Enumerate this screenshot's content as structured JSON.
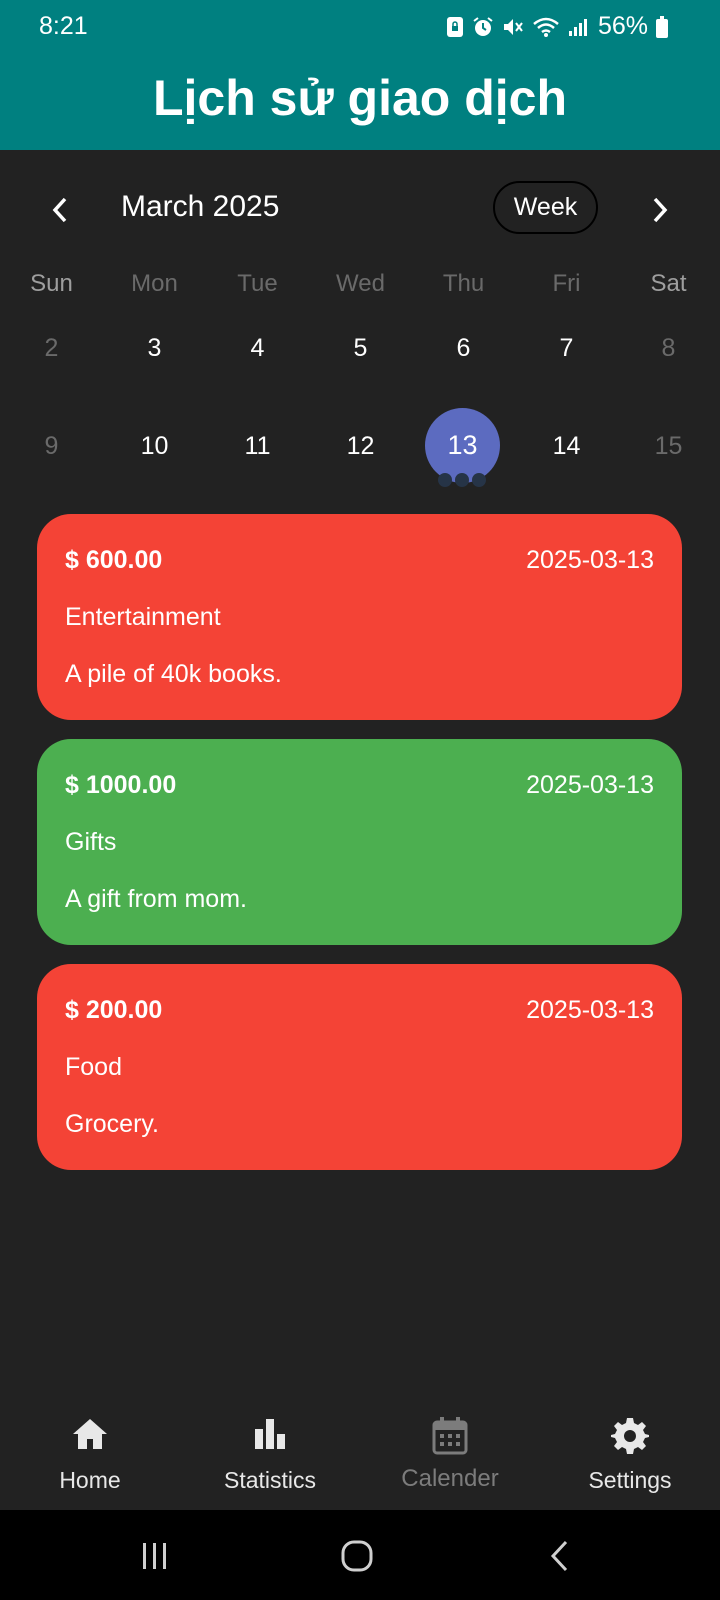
{
  "status_bar": {
    "time": "8:21",
    "battery": "56%"
  },
  "app_bar": {
    "title": "Lịch sử giao dịch"
  },
  "calendar": {
    "month": "March 2025",
    "format_button": "Week",
    "weekdays": [
      "Sun",
      "Mon",
      "Tue",
      "Wed",
      "Thu",
      "Fri",
      "Sat"
    ],
    "weeks": [
      [
        "2",
        "3",
        "4",
        "5",
        "6",
        "7",
        "8"
      ],
      [
        "9",
        "10",
        "11",
        "12",
        "13",
        "14",
        "15"
      ]
    ],
    "selected_day": "13"
  },
  "events": [
    {
      "amount": "$ 600.00",
      "date": "2025-03-13",
      "category": "Entertainment",
      "note": "A pile of 40k books.",
      "color": "#f44336"
    },
    {
      "amount": "$ 1000.00",
      "date": "2025-03-13",
      "category": "Gifts",
      "note": "A gift from mom.",
      "color": "#4caf50"
    },
    {
      "amount": "$ 200.00",
      "date": "2025-03-13",
      "category": "Food",
      "note": "Grocery.",
      "color": "#f44336"
    }
  ],
  "bottom_nav": [
    {
      "label": "Home",
      "icon": "home-icon"
    },
    {
      "label": "Statistics",
      "icon": "bar-chart-icon"
    },
    {
      "label": "Calender",
      "icon": "calendar-icon",
      "active": true
    },
    {
      "label": "Settings",
      "icon": "gear-icon"
    }
  ],
  "colors": {
    "app_bar": "#008080",
    "background": "#222222",
    "selected_day": "#5c6bc0",
    "expense": "#f44336",
    "income": "#4caf50"
  }
}
